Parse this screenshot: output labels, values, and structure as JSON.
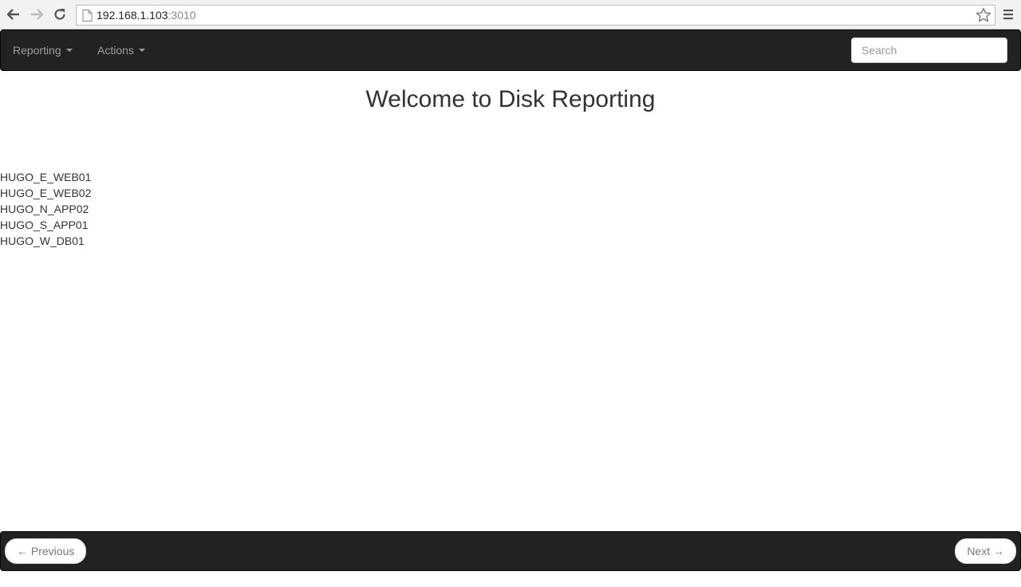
{
  "browser": {
    "url_host": "192.168.1.103",
    "url_port": ":3010"
  },
  "navbar": {
    "menus": [
      {
        "label": "Reporting"
      },
      {
        "label": "Actions"
      }
    ],
    "search_placeholder": "Search"
  },
  "main": {
    "title": "Welcome to Disk Reporting",
    "servers": [
      "HUGO_E_WEB01",
      "HUGO_E_WEB02",
      "HUGO_N_APP02",
      "HUGO_S_APP01",
      "HUGO_W_DB01"
    ]
  },
  "footer": {
    "previous_label": "← Previous",
    "next_label": "Next →"
  }
}
